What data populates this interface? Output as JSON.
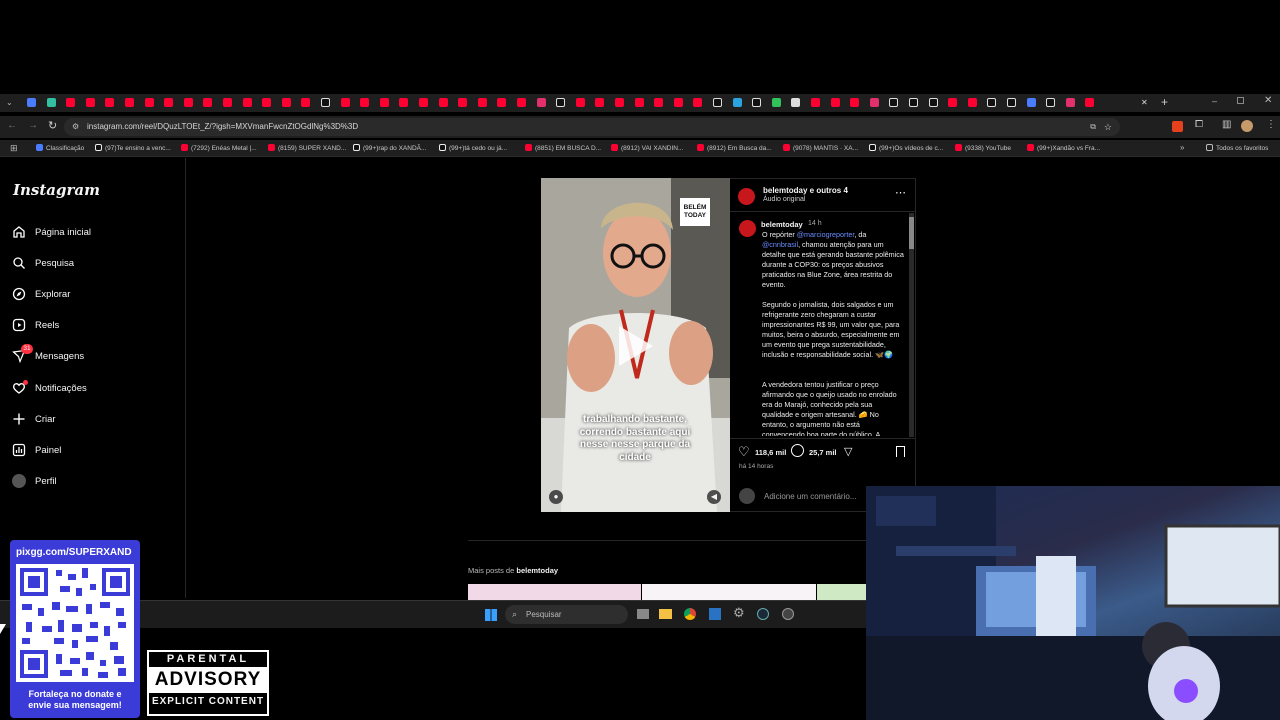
{
  "browser": {
    "url": "instagram.com/reel/DQuzLTOEt_Z/?igsh=MXVmanFwcnZtOGdlNg%3D%3D",
    "bookmarks": [
      "Classificação",
      "(97)Te ensino a venc...",
      "(7292) Enéas Metal |...",
      "(8159) SUPER XAND...",
      "(99+)rap do XANDÃ...",
      "(99+)tá cedo ou já...",
      "(8851) EM BUSCA D...",
      "(8912) VAI XANDIN...",
      "(8912) Em Busca da...",
      "(9078) MANTIS · XA...",
      "(99+)Os vídeos de c...",
      "(9338) YouTube",
      "(99+)Xandão vs Fra...",
      "Todos os favoritos"
    ]
  },
  "sidebar": {
    "logo": "Instagram",
    "items": [
      {
        "label": "Página inicial",
        "icon": "home-icon"
      },
      {
        "label": "Pesquisa",
        "icon": "search-icon"
      },
      {
        "label": "Explorar",
        "icon": "compass-icon"
      },
      {
        "label": "Reels",
        "icon": "reels-icon"
      },
      {
        "label": "Mensagens",
        "icon": "messages-icon",
        "badge": "31"
      },
      {
        "label": "Notificações",
        "icon": "heart-icon"
      },
      {
        "label": "Criar",
        "icon": "plus-icon"
      },
      {
        "label": "Painel",
        "icon": "dashboard-icon"
      },
      {
        "label": "Perfil",
        "icon": "avatar-icon"
      }
    ]
  },
  "reel": {
    "badge_line1": "BELÉM",
    "badge_line2": "TODAY",
    "subtitle": "trabalhando bastante, correndo bastante aqui nesse nesse parque da cidade"
  },
  "post": {
    "header_user": "belemtoday e outros 4",
    "audio": "Áudio original",
    "author": "belemtoday",
    "time": "14 h",
    "caption_p1_a": "O repórter ",
    "caption_p1_link1": "@marciogreporter",
    "caption_p1_b": ", da ",
    "caption_p1_link2": "@cnnbrasil",
    "caption_p1_c": ", chamou atenção para um detalhe que está gerando bastante polêmica durante a COP30: os preços abusivos praticados na Blue Zone, área restrita do evento.",
    "caption_p2": "Segundo o jornalista, dois salgados e um refrigerante zero chegaram a custar impressionantes R$ 99,  um valor que, para muitos, beira o absurdo, especialmente em um evento que prega sustentabilidade, inclusão e responsabilidade social. 🦋🌍",
    "caption_p3": "A vendedora tentou justificar o preço afirmando que o queijo usado no enrolado era do Marajó, conhecido pela sua qualidade e origem artesanal. 🧀 No entanto, o argumento não está convencendo boa parte do público. A",
    "likes": "118,6 mil",
    "comments": "25,7 mil",
    "posted": "há 14 horas",
    "comment_placeholder": "Adicione um comentário...",
    "more_posts_prefix": "Mais posts de ",
    "more_posts_user": "belemtoday"
  },
  "taskbar": {
    "search_placeholder": "Pesquisar"
  },
  "overlay": {
    "pix_url": "pixgg.com/SUPERXAND",
    "donate_line1": "Fortaleça no donate e",
    "donate_line2": "envie sua mensagem!",
    "advisory_top": "PARENTAL",
    "advisory_mid": "ADVISORY",
    "advisory_bottom": "EXPLICIT CONTENT"
  },
  "colors": {
    "accent_link": "#6b8cff",
    "badge_red": "#ff3040",
    "youtube_red": "#ff0033",
    "pix_blue": "#3b3bd8"
  }
}
